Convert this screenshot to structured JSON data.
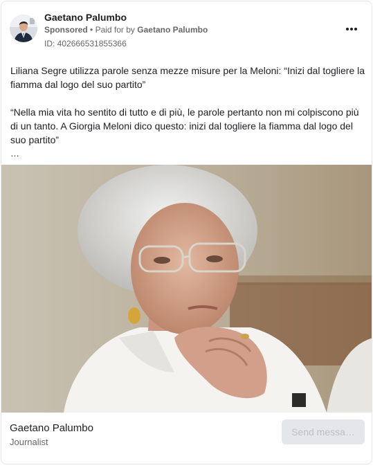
{
  "header": {
    "page_name": "Gaetano Palumbo",
    "sponsored_label": "Sponsored",
    "separator": "•",
    "paid_for_prefix": "Paid for by",
    "payer_name": "Gaetano Palumbo",
    "ad_id": "ID: 402666531855366",
    "more_icon": "more-horizontal-icon"
  },
  "post": {
    "paragraph_1": "Liliana Segre utilizza parole senza mezze misure per la Meloni: “Inizi dal togliere la fiamma dal logo del suo partito”",
    "paragraph_2": "“Nella mia vita ho sentito di tutto e di più, le parole pertanto non mi colpiscono più di un tanto. A Giorgia Meloni dico questo: inizi dal togliere la fiamma dal logo del suo partito”",
    "truncation": "…"
  },
  "footer": {
    "name": "Gaetano Palumbo",
    "subtitle": "Journalist",
    "cta_label": "Send messa…"
  },
  "colors": {
    "text_primary": "#1c1e21",
    "text_secondary": "#65676b",
    "button_bg": "#e4e6eb",
    "button_text": "#bcc0c4"
  }
}
